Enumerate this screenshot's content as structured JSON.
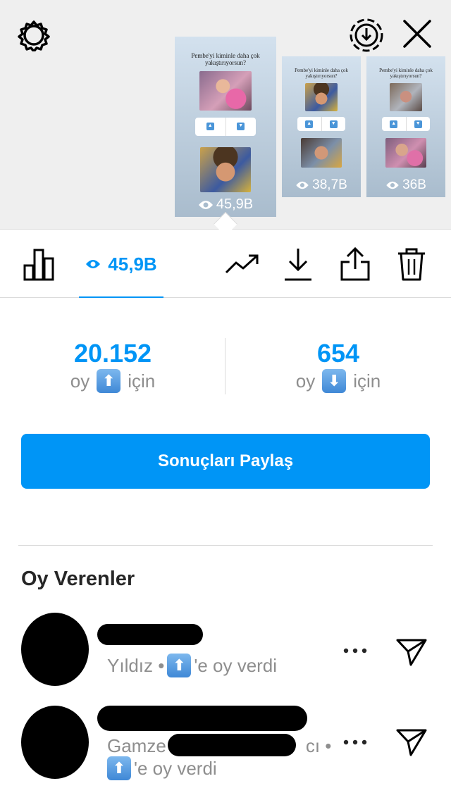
{
  "colors": {
    "accent": "#0095f6",
    "muted": "#8e8e8e",
    "text": "#262626",
    "top_bg": "#efefef"
  },
  "top": {
    "icons": {
      "settings": "gear-icon",
      "download": "download-circle-icon",
      "close": "close-icon"
    }
  },
  "stories": [
    {
      "title": "Pembe'yi kiminle daha çok yakıştırıyorsun?",
      "views": "45,9B",
      "selected": true
    },
    {
      "title": "Pembe'yi kiminle daha çok yakıştırıyorsun?",
      "views": "38,7B",
      "selected": false
    },
    {
      "title": "Pembe'yi kiminle daha çok yakıştırıyorsun?",
      "views": "36B",
      "selected": false
    }
  ],
  "toolbar": {
    "views": "45,9B",
    "icons": [
      "bar-chart-icon",
      "eye-icon",
      "trend-icon",
      "download-icon",
      "share-icon",
      "trash-icon"
    ]
  },
  "results": {
    "up": {
      "count": "20.152",
      "prefix": "oy",
      "emoji": "⬆",
      "suffix": "için"
    },
    "down": {
      "count": "654",
      "prefix": "oy",
      "emoji": "⬇",
      "suffix": "için"
    }
  },
  "share_button": "Sonuçları Paylaş",
  "voters_title": "Oy Verenler",
  "voters": [
    {
      "name_visible": "Yıldız •",
      "emoji": "⬆",
      "action": "'e oy verdi"
    },
    {
      "name_visible": "Gamze",
      "name_tail": "cı •",
      "emoji": "⬆",
      "action": "'e oy verdi"
    }
  ]
}
